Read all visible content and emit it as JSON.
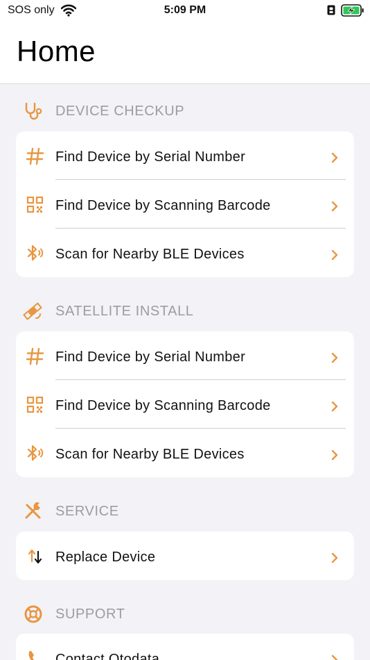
{
  "status_bar": {
    "carrier": "SOS only",
    "time": "5:09 PM",
    "icons": [
      "wifi-icon",
      "lock-icon",
      "battery-charging-icon"
    ]
  },
  "page": {
    "title": "Home"
  },
  "theme": {
    "accent": "#e8963f",
    "header_text": "#9c9ca1",
    "background": "#f2f2f7",
    "card": "#ffffff"
  },
  "sections": [
    {
      "label": "DEVICE CHECKUP",
      "icon": "stethoscope-icon",
      "items": [
        {
          "label": "Find Device by Serial Number",
          "icon": "hash-icon"
        },
        {
          "label": "Find Device by Scanning Barcode",
          "icon": "qr-code-icon"
        },
        {
          "label": "Scan for Nearby BLE Devices",
          "icon": "bluetooth-icon"
        }
      ]
    },
    {
      "label": "SATELLITE INSTALL",
      "icon": "satellite-icon",
      "items": [
        {
          "label": "Find Device by Serial Number",
          "icon": "hash-icon"
        },
        {
          "label": "Find Device by Scanning Barcode",
          "icon": "qr-code-icon"
        },
        {
          "label": "Scan for Nearby BLE Devices",
          "icon": "bluetooth-icon"
        }
      ]
    },
    {
      "label": "SERVICE",
      "icon": "tools-icon",
      "items": [
        {
          "label": "Replace Device",
          "icon": "swap-arrows-icon"
        }
      ]
    },
    {
      "label": "SUPPORT",
      "icon": "lifebuoy-icon",
      "items": [
        {
          "label": "Contact Otodata",
          "icon": "phone-icon"
        }
      ]
    }
  ]
}
